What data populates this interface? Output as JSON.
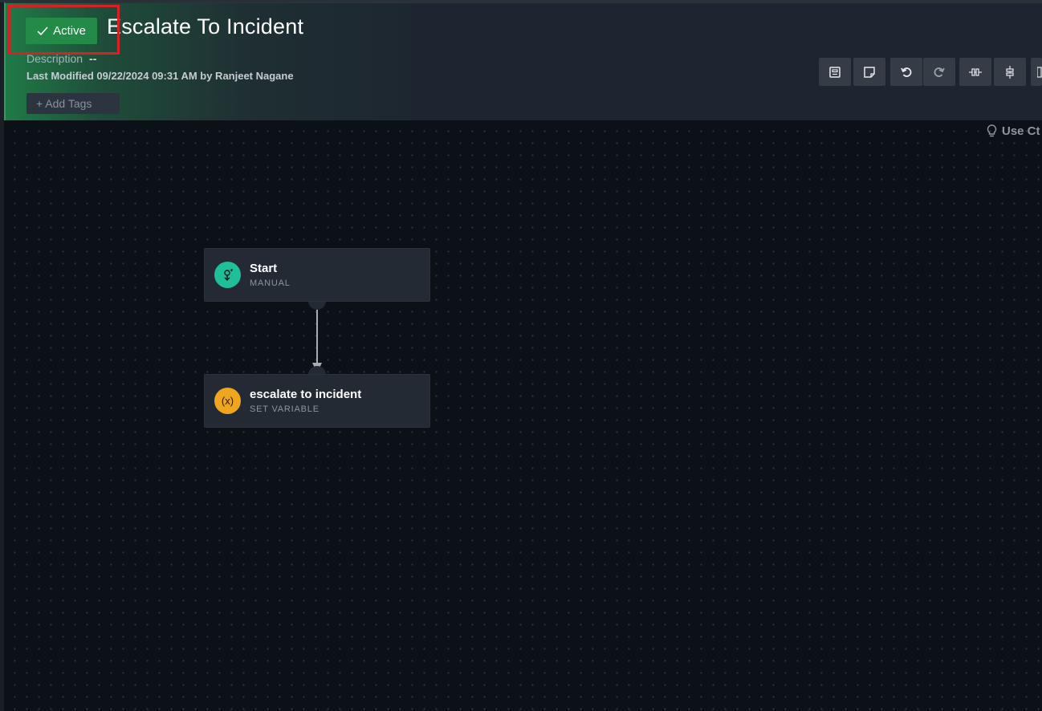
{
  "header": {
    "status_label": "Active",
    "title": "Escalate To Incident",
    "description_label": "Description",
    "description_value": "--",
    "last_modified": "Last Modified 09/22/2024 09:31 AM by Ranjeet Nagane",
    "add_tags_label": "+ Add Tags"
  },
  "toolbar": {
    "icons": [
      "summary-icon",
      "note-icon",
      "undo-icon",
      "redo-icon",
      "horizontal-layout-icon",
      "vertical-layout-icon",
      "more-icon"
    ]
  },
  "canvas": {
    "hint_text": "Use Ct",
    "nodes": [
      {
        "title": "Start",
        "subtitle": "MANUAL",
        "icon": "manual-trigger-icon",
        "color": "#1fbf9a"
      },
      {
        "title": "escalate to incident",
        "subtitle": "SET VARIABLE",
        "icon": "variable-icon",
        "icon_text": "(x)",
        "color": "#f0a51f"
      }
    ]
  },
  "colors": {
    "accent_green": "#238a47",
    "highlight_red": "#d92027",
    "canvas_bg": "#0c1118"
  }
}
